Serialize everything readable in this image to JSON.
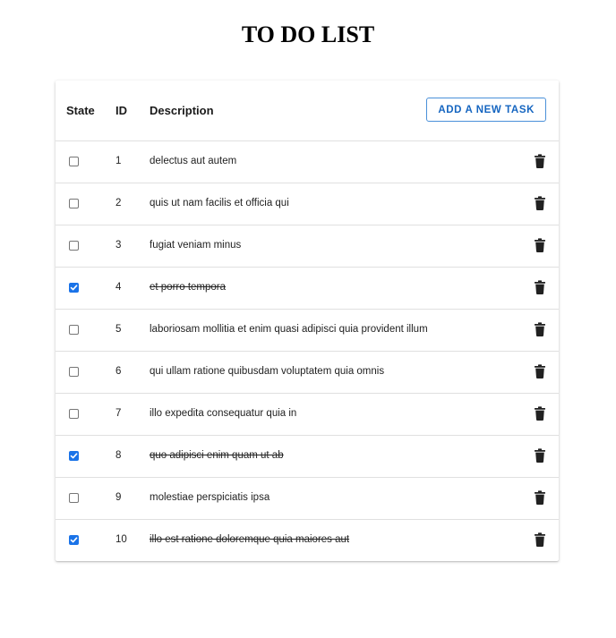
{
  "page": {
    "title": "TO DO LIST"
  },
  "table": {
    "headers": {
      "state": "State",
      "id": "ID",
      "description": "Description"
    },
    "add_button_label": "ADD A NEW TASK",
    "rows": [
      {
        "done": false,
        "id": "1",
        "description": "delectus aut autem"
      },
      {
        "done": false,
        "id": "2",
        "description": "quis ut nam facilis et officia qui"
      },
      {
        "done": false,
        "id": "3",
        "description": "fugiat veniam minus"
      },
      {
        "done": true,
        "id": "4",
        "description": "et porro tempora"
      },
      {
        "done": false,
        "id": "5",
        "description": "laboriosam mollitia et enim quasi adipisci quia provident illum"
      },
      {
        "done": false,
        "id": "6",
        "description": "qui ullam ratione quibusdam voluptatem quia omnis"
      },
      {
        "done": false,
        "id": "7",
        "description": "illo expedita consequatur quia in"
      },
      {
        "done": true,
        "id": "8",
        "description": "quo adipisci enim quam ut ab"
      },
      {
        "done": false,
        "id": "9",
        "description": "molestiae perspiciatis ipsa"
      },
      {
        "done": true,
        "id": "10",
        "description": "illo est ratione doloremque quia maiores aut"
      }
    ]
  },
  "icons": {
    "row_action": "trash-icon"
  },
  "colors": {
    "accent": "#1a73e8",
    "button_text": "#1565c0",
    "button_border": "#4a90d9"
  }
}
